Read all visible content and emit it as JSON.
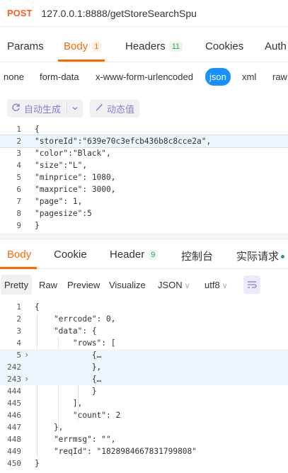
{
  "request": {
    "method": "POST",
    "url": "127.0.0.1:8888/getStoreSearchSpu"
  },
  "req_tabs": [
    {
      "label": "Params",
      "badge": ""
    },
    {
      "label": "Body",
      "badge": "1"
    },
    {
      "label": "Headers",
      "badge": "11"
    },
    {
      "label": "Cookies",
      "badge": ""
    },
    {
      "label": "Auth",
      "badge": ""
    }
  ],
  "body_types": [
    "none",
    "form-data",
    "x-www-form-urlencoded",
    "json",
    "xml",
    "raw"
  ],
  "toolbar": {
    "auto_generate": "自动生成",
    "dynamic_value": "动态值"
  },
  "request_body": {
    "line_numbers": [
      "1",
      "2",
      "3",
      "4",
      "5",
      "6",
      "7",
      "8",
      "9"
    ],
    "lines": [
      "{",
      "\"storeId\":\"639e70c3efcb436b8c8cce2a\",",
      "\"color\":\"Black\",",
      "\"size\":\"L\",",
      "\"minprice\": 1080,",
      "\"maxprice\": 3000,",
      "\"page\": 1,",
      "\"pagesize\":5",
      "}"
    ]
  },
  "resp_tabs": [
    {
      "label": "Body",
      "badge": ""
    },
    {
      "label": "Cookie",
      "badge": ""
    },
    {
      "label": "Header",
      "badge": "9"
    },
    {
      "label": "控制台",
      "badge": ""
    },
    {
      "label": "实际请求",
      "badge": ""
    }
  ],
  "resp_tools": {
    "pretty": "Pretty",
    "raw": "Raw",
    "preview": "Preview",
    "visualize": "Visualize",
    "format": "JSON",
    "encoding": "utf8"
  },
  "response_body": {
    "line_numbers": [
      "1",
      "2",
      "3",
      "4",
      "5",
      "242",
      "243",
      "444",
      "445",
      "446",
      "447",
      "448",
      "449",
      "450"
    ],
    "lines": [
      "{",
      "    \"errcode\": 0,",
      "    \"data\": {",
      "        \"rows\": [",
      "            {…",
      "            },",
      "            {…",
      "            }",
      "        ],",
      "        \"count\": 2",
      "    },",
      "    \"errmsg\": \"\",",
      "    \"reqId\": \"1828984667831799808\"",
      "}"
    ]
  },
  "colors": {
    "method": "#ff5a1f",
    "accent": "#ff6a00",
    "json_pill": "#1890ff",
    "tool_purple": "#8a7dcf",
    "success": "#29a35a"
  }
}
